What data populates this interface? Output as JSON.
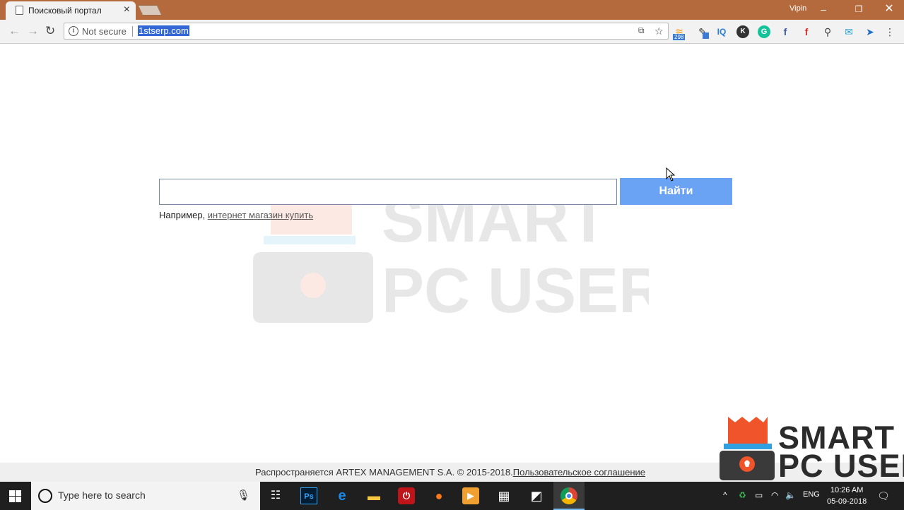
{
  "browser": {
    "tab_title": "Поисковый портал",
    "profile_name": "Vipin",
    "security_label": "Not secure",
    "url": "1stserp.com",
    "extensions": [
      {
        "name": "rss-extension-icon",
        "badge": "298"
      },
      {
        "name": "eyedropper-extension-icon"
      },
      {
        "name": "iq-extension-icon",
        "label": "IQ"
      },
      {
        "name": "k-extension-icon",
        "label": "K"
      },
      {
        "name": "grammarly-extension-icon",
        "label": "G"
      },
      {
        "name": "facebook-extension-icon",
        "label": "f"
      },
      {
        "name": "facebook-red-extension-icon",
        "label": "f"
      },
      {
        "name": "search-extension-icon"
      },
      {
        "name": "mail-extension-icon"
      },
      {
        "name": "send-extension-icon"
      }
    ]
  },
  "page": {
    "search_button": "Найти",
    "example_prefix": "Например, ",
    "example_link": "интернет магазин купить",
    "footer_text": "Распространяется ARTEX MANAGEMENT S.A. © 2015-2018.",
    "footer_link": "Пользовательское соглашение"
  },
  "watermark": {
    "line1": "SMART",
    "line2": "PC USER"
  },
  "taskbar": {
    "search_placeholder": "Type here to search",
    "language": "ENG",
    "time": "10:26 AM",
    "date": "05-09-2018"
  },
  "colors": {
    "titlebar": "#b46a3c",
    "search_button": "#6ba3f4",
    "logo_orange": "#f0542a"
  }
}
